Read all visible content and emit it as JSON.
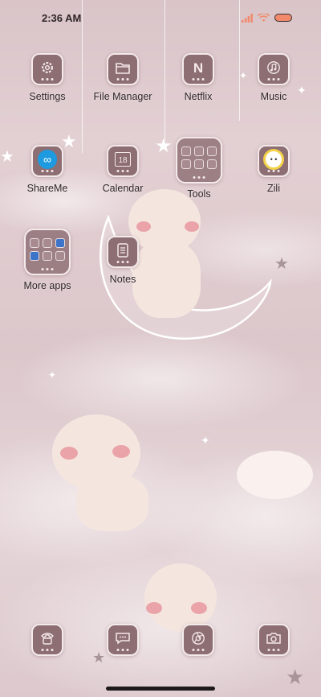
{
  "status": {
    "time": "2:36 AM",
    "signal_icon": "signal-icon",
    "wifi_icon": "wifi-icon",
    "battery_icon": "battery-icon",
    "battery_color": "#f08a6a"
  },
  "apps": {
    "settings": {
      "label": "Settings",
      "icon": "gear-icon"
    },
    "file_manager": {
      "label": "File Manager",
      "icon": "folder-icon"
    },
    "netflix": {
      "label": "Netflix",
      "icon": "netflix-icon",
      "glyph": "N"
    },
    "music": {
      "label": "Music",
      "icon": "music-note-icon"
    },
    "shareme": {
      "label": "ShareMe",
      "icon": "shareme-icon"
    },
    "calendar": {
      "label": "Calendar",
      "icon": "calendar-icon",
      "day": "18"
    },
    "tools": {
      "label": "Tools",
      "icon": "folder-tools-icon"
    },
    "zili": {
      "label": "Zili",
      "icon": "zili-icon"
    },
    "more_apps": {
      "label": "More apps",
      "icon": "folder-more-apps-icon"
    },
    "notes": {
      "label": "Notes",
      "icon": "notes-icon"
    }
  },
  "dock": [
    {
      "name": "phone",
      "icon": "phone-icon"
    },
    {
      "name": "messages",
      "icon": "message-icon"
    },
    {
      "name": "browser",
      "icon": "browser-icon"
    },
    {
      "name": "camera",
      "icon": "camera-icon"
    }
  ],
  "theme": {
    "tile_color": "#8c6e73",
    "tile_border": "#f4eaeb",
    "label_color": "#2e2427"
  }
}
